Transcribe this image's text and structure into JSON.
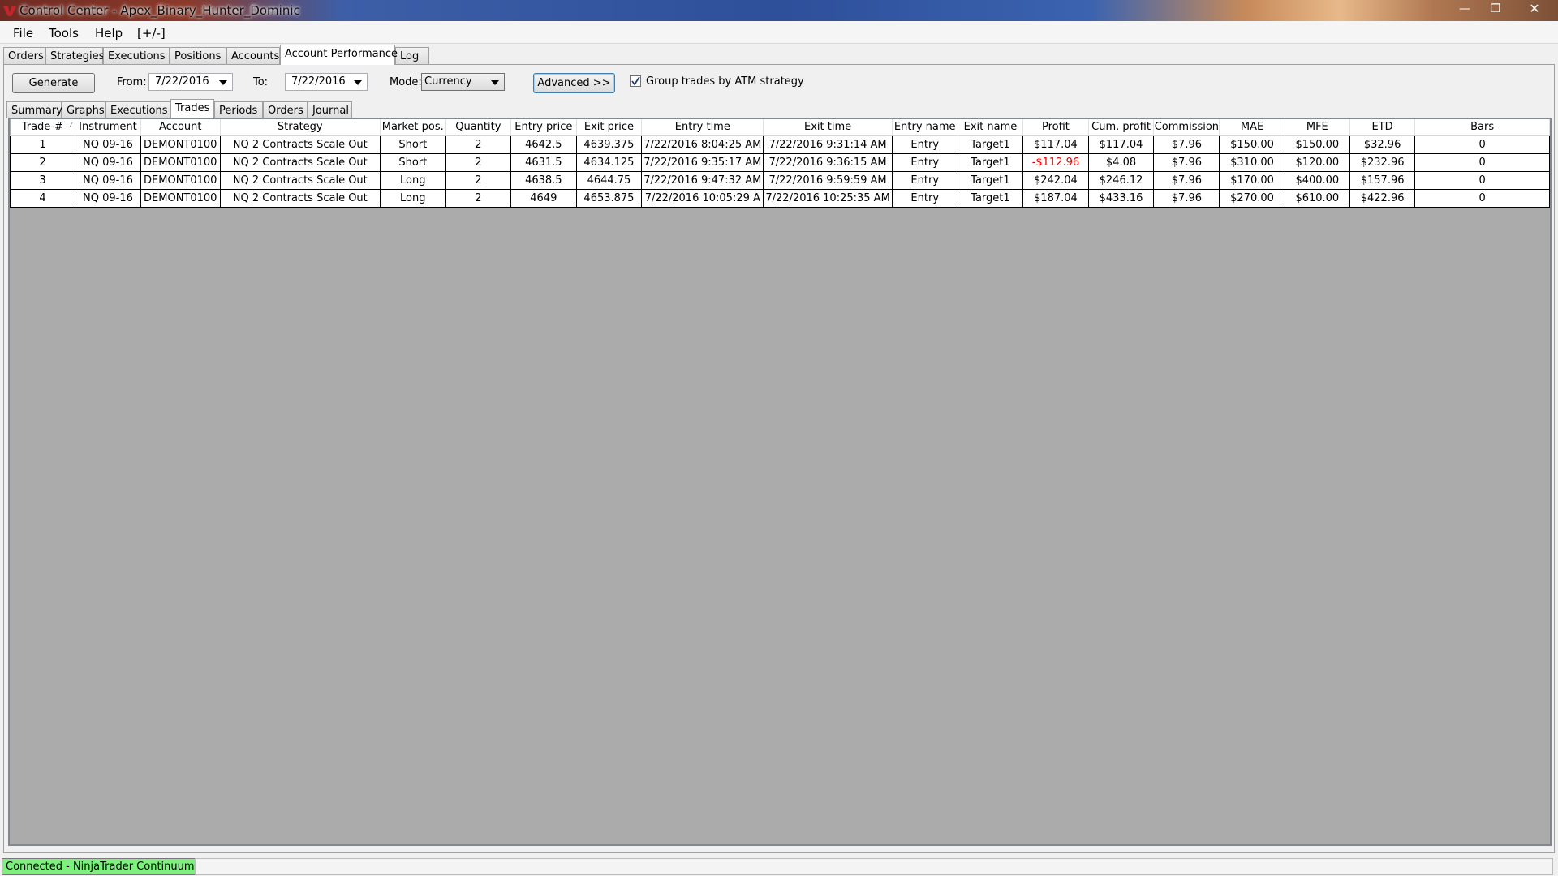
{
  "window": {
    "title": "Control Center - Apex_Binary_Hunter_Dominic",
    "minimize": "—",
    "maximize": "❐",
    "close": "✕"
  },
  "menu": [
    "File",
    "Tools",
    "Help",
    "[+/-]"
  ],
  "main_tabs": [
    "Orders",
    "Strategies",
    "Executions",
    "Positions",
    "Accounts",
    "Account Performance",
    "Log"
  ],
  "main_tabs_active": "Account Performance",
  "toolbar": {
    "generate": "Generate",
    "from_label": "From:",
    "from_value": "7/22/2016",
    "to_label": "To:",
    "to_value": "7/22/2016",
    "mode_label": "Mode:",
    "mode_value": "Currency",
    "advanced": "Advanced >>",
    "group_checkbox_label": "Group trades by ATM strategy",
    "group_checked": true
  },
  "sub_tabs": [
    "Summary",
    "Graphs",
    "Executions",
    "Trades",
    "Periods",
    "Orders",
    "Journal"
  ],
  "sub_tabs_active": "Trades",
  "trades_table": {
    "columns": [
      "Trade-#",
      "Instrument",
      "Account",
      "Strategy",
      "Market pos.",
      "Quantity",
      "Entry price",
      "Exit price",
      "Entry time",
      "Exit time",
      "Entry name",
      "Exit name",
      "Profit",
      "Cum. profit",
      "Commission",
      "MAE",
      "MFE",
      "ETD",
      "Bars"
    ],
    "rows": [
      [
        "1",
        "NQ 09-16",
        "DEMONT0100",
        "NQ 2 Contracts Scale Out",
        "Short",
        "2",
        "4642.5",
        "4639.375",
        "7/22/2016 8:04:25 AM",
        "7/22/2016 9:31:14 AM",
        "Entry",
        "Target1",
        "$117.04",
        "$117.04",
        "$7.96",
        "$150.00",
        "$150.00",
        "$32.96",
        "0"
      ],
      [
        "2",
        "NQ 09-16",
        "DEMONT0100",
        "NQ 2 Contracts Scale Out",
        "Short",
        "2",
        "4631.5",
        "4634.125",
        "7/22/2016 9:35:17 AM",
        "7/22/2016 9:36:15 AM",
        "Entry",
        "Target1",
        "-$112.96",
        "$4.08",
        "$7.96",
        "$310.00",
        "$120.00",
        "$232.96",
        "0"
      ],
      [
        "3",
        "NQ 09-16",
        "DEMONT0100",
        "NQ 2 Contracts Scale Out",
        "Long",
        "2",
        "4638.5",
        "4644.75",
        "7/22/2016 9:47:32 AM",
        "7/22/2016 9:59:59 AM",
        "Entry",
        "Target1",
        "$242.04",
        "$246.12",
        "$7.96",
        "$170.00",
        "$400.00",
        "$157.96",
        "0"
      ],
      [
        "4",
        "NQ 09-16",
        "DEMONT0100",
        "NQ 2 Contracts Scale Out",
        "Long",
        "2",
        "4649",
        "4653.875",
        "7/22/2016 10:05:29 A",
        "7/22/2016 10:25:35 AM",
        "Entry",
        "Target1",
        "$187.04",
        "$433.16",
        "$7.96",
        "$270.00",
        "$610.00",
        "$422.96",
        "0"
      ]
    ],
    "negative_color": "#e00000"
  },
  "status": {
    "connection": "Connected - NinjaTrader Continuum",
    "connection_color": "#7df07d"
  }
}
